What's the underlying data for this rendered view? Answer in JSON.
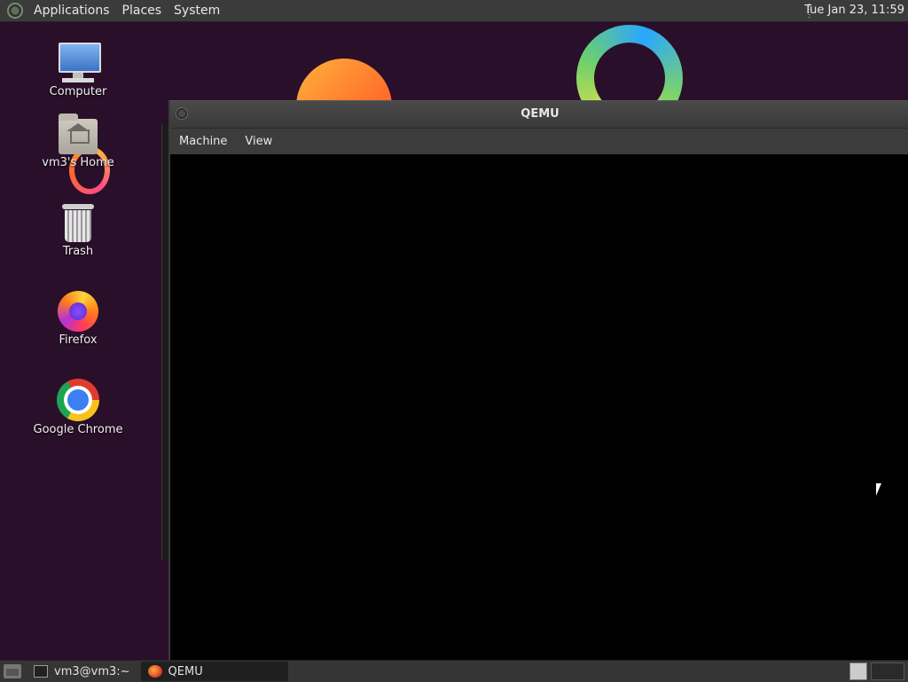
{
  "top_panel": {
    "menus": [
      "Applications",
      "Places",
      "System"
    ],
    "clock": "Tue Jan 23, 11:59"
  },
  "desktop": {
    "icons": [
      {
        "label": "Computer",
        "icon": "computer-icon"
      },
      {
        "label": "vm3's Home",
        "icon": "home-folder-icon"
      },
      {
        "label": "Trash",
        "icon": "trash-icon"
      },
      {
        "label": "Firefox",
        "icon": "firefox-icon"
      },
      {
        "label": "Google Chrome",
        "icon": "chrome-icon"
      }
    ]
  },
  "qemu": {
    "title": "QEMU",
    "menus": [
      "Machine",
      "View"
    ]
  },
  "bottom_panel": {
    "tasks": [
      {
        "label": "vm3@vm3:~",
        "icon": "terminal-icon"
      },
      {
        "label": "QEMU",
        "icon": "qemu-icon"
      }
    ]
  },
  "colors": {
    "wallpaper": "#2a0f2a",
    "panel": "#3b3b3b"
  }
}
